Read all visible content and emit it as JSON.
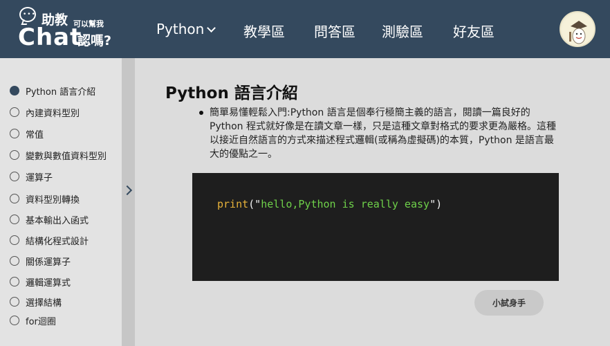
{
  "header": {
    "logo": {
      "top": "助教",
      "main": "Chat",
      "small": "可以幫我",
      "ask": "認嗎?"
    },
    "nav": [
      {
        "label": "Python",
        "has_dropdown": true
      },
      {
        "label": "教學區"
      },
      {
        "label": "問答區"
      },
      {
        "label": "測驗區"
      },
      {
        "label": "好友區"
      }
    ],
    "colors": {
      "header_bg": "#34495e"
    }
  },
  "sidebar": {
    "items": [
      {
        "label": "Python 語言介紹",
        "active": true
      },
      {
        "label": "內建資料型別"
      },
      {
        "label": "常值"
      },
      {
        "label": "變數與數值資料型別"
      },
      {
        "label": "運算子"
      },
      {
        "label": "資料型別轉換"
      },
      {
        "label": "基本輸出入函式"
      },
      {
        "label": "結構化程式設計"
      },
      {
        "label": "關係運算子"
      },
      {
        "label": "邏輯運算式"
      },
      {
        "label": "選擇結構"
      },
      {
        "label": "for迴圈"
      }
    ]
  },
  "main": {
    "title": "Python  語言介紹",
    "description": "簡單易懂輕鬆入門:Python 語言是個奉行極簡主義的語言，閱讀一篇良好的 Python 程式就好像是在讀文章一樣，只是這種文章對格式的要求更為嚴格。這種以接近自然語言的方式來描述程式邏輯(或稱為虛擬碼)的本質，Python 是語言最大的優點之一。",
    "code": {
      "fn": "print",
      "open": "(\"",
      "string": "hello,Python is really easy",
      "close": "\")"
    },
    "try_button": "小試身手"
  }
}
